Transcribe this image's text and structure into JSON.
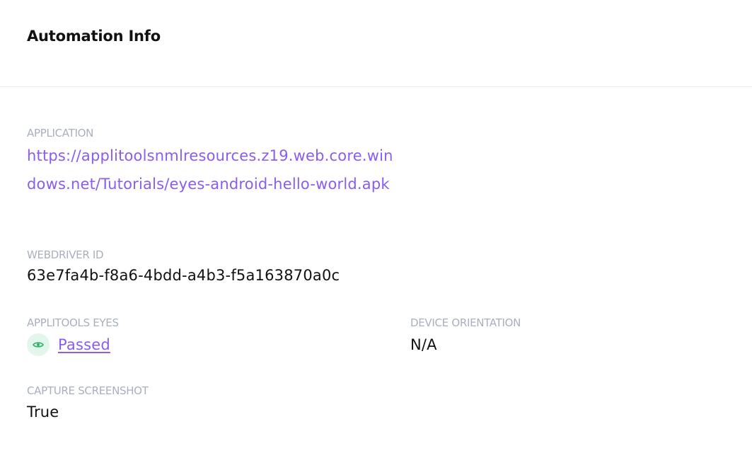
{
  "panel": {
    "title": "Automation Info"
  },
  "fields": {
    "application": {
      "label": "APPLICATION",
      "value": "https://applitoolsnmlresources.z19.web.core.windows.net/Tutorials/eyes-android-hello-world.apk"
    },
    "webdriver_id": {
      "label": "WEBDRIVER ID",
      "value": "63e7fa4b-f8a6-4bdd-a4b3-f5a163870a0c"
    },
    "applitools_eyes": {
      "label": "APPLITOOLS EYES",
      "value": "Passed",
      "icon": "eye-icon",
      "status_color": "#2fb26b"
    },
    "device_orientation": {
      "label": "DEVICE ORIENTATION",
      "value": "N/A"
    },
    "capture_screenshot": {
      "label": "CAPTURE SCREENSHOT",
      "value": "True"
    }
  },
  "colors": {
    "link": "#8a5cf0",
    "label": "#a9b0bc",
    "text": "#111111",
    "divider": "#e9ebef",
    "badge_bg": "#e3f6ec"
  }
}
